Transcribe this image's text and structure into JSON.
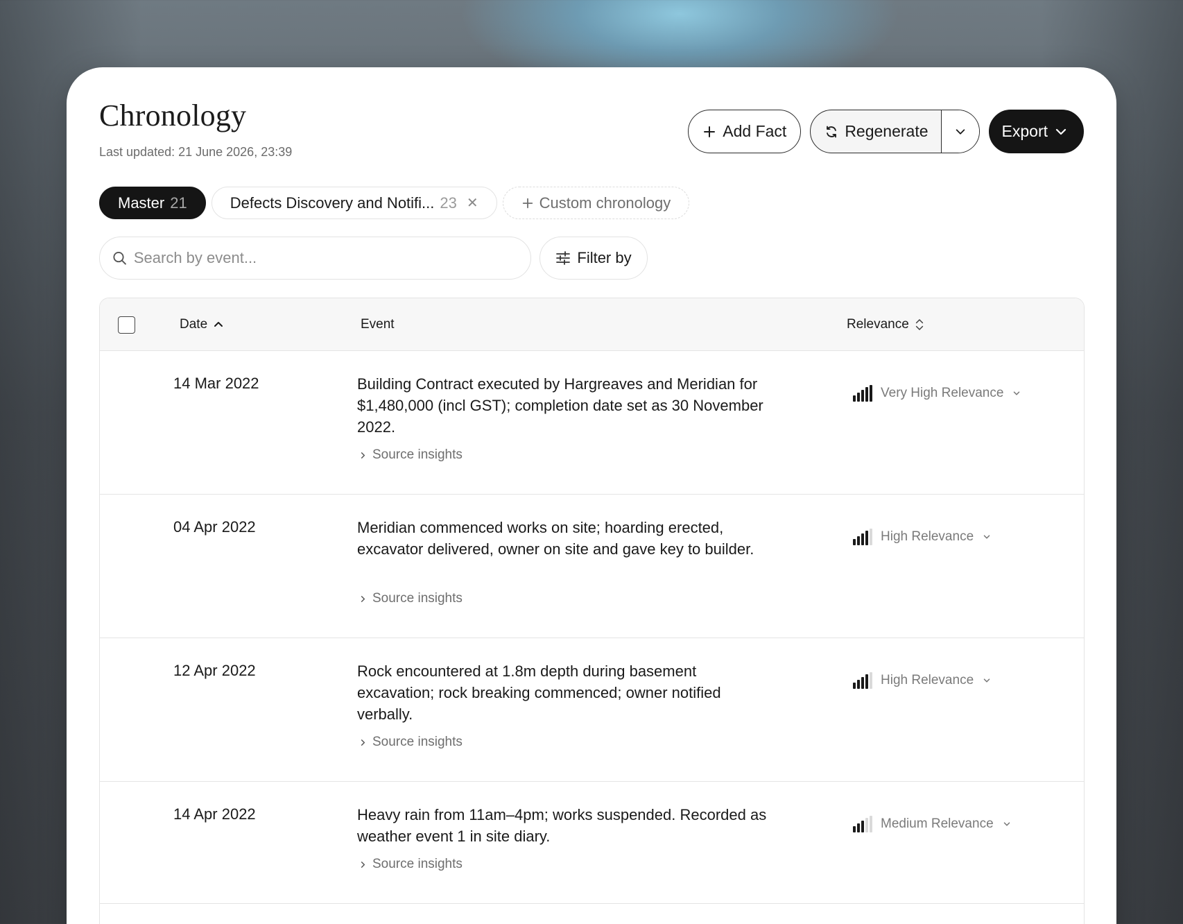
{
  "header": {
    "title": "Chronology",
    "last_updated": "Last updated: 21 June 2026, 23:39"
  },
  "actions": {
    "add_fact": "Add Fact",
    "regenerate": "Regenerate",
    "export": "Export"
  },
  "tabs": [
    {
      "label": "Master",
      "count": "21"
    },
    {
      "label": "Defects Discovery and Notifi...",
      "count": "23"
    },
    {
      "label": "Custom chronology"
    }
  ],
  "search": {
    "placeholder": "Search by event..."
  },
  "filter": {
    "label": "Filter by"
  },
  "table": {
    "columns": {
      "date": "Date",
      "event": "Event",
      "relevance": "Relevance"
    },
    "rows": [
      {
        "date": "14 Mar 2022",
        "event": "Building Contract executed by Hargreaves and Meridian for $1,480,000 (incl GST); completion date set as 30 November 2022.",
        "insights": "Source insights",
        "relevance": "Very High Relevance",
        "relevance_level": 5
      },
      {
        "date": "04 Apr 2022",
        "event": "Meridian commenced works on site; hoarding erected, excavator delivered, owner on site and gave key to builder.",
        "insights": "Source insights",
        "relevance": "High Relevance",
        "relevance_level": 4
      },
      {
        "date": "12 Apr 2022",
        "event": "Rock encountered at 1.8m depth during basement excavation; rock breaking commenced; owner notified verbally.",
        "insights": "Source insights",
        "relevance": "High Relevance",
        "relevance_level": 4
      },
      {
        "date": "14 Apr 2022",
        "event": "Heavy rain from 11am–4pm; works suspended. Recorded as weather event 1 in site diary.",
        "insights": "Source insights",
        "relevance": "Medium Relevance",
        "relevance_level": 3
      }
    ]
  }
}
